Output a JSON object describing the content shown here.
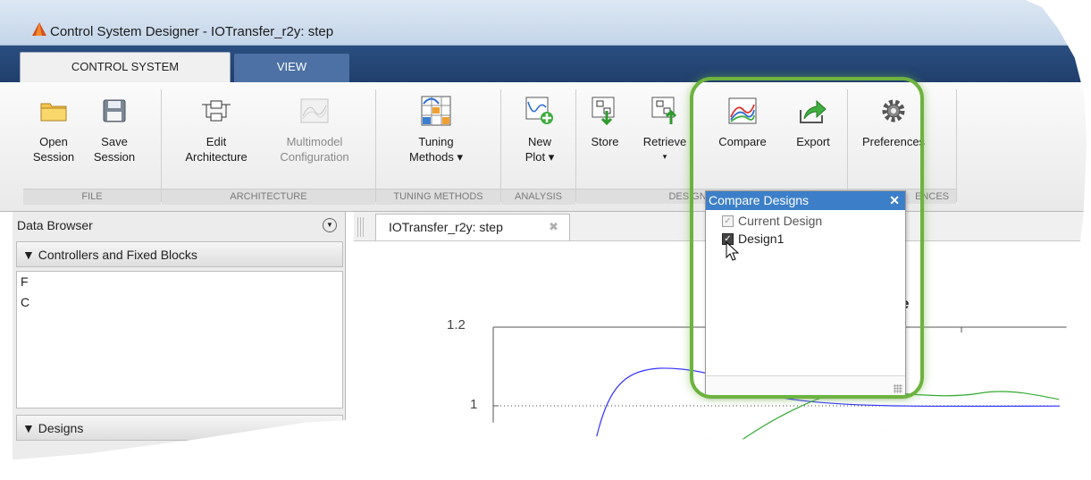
{
  "window": {
    "title": "Control System Designer - IOTransfer_r2y: step"
  },
  "tabs": [
    {
      "label": "CONTROL SYSTEM"
    },
    {
      "label": "VIEW"
    }
  ],
  "quick_access": [
    "help-icon",
    "dock-icon",
    "save-icon",
    "cut-icon"
  ],
  "ribbon": {
    "buttons": [
      {
        "line1": "Open",
        "line2": "Session",
        "icon": "folder-icon"
      },
      {
        "line1": "Save",
        "line2": "Session",
        "icon": "floppy-icon"
      },
      {
        "line1": "Edit",
        "line2": "Architecture",
        "icon": "block-diagram-icon"
      },
      {
        "line1": "Multimodel",
        "line2": "Configuration",
        "icon": "multimodel-icon",
        "disabled": true
      },
      {
        "line1": "Tuning",
        "line2": "Methods ▾",
        "icon": "tuning-icon"
      },
      {
        "line1": "New",
        "line2": "Plot ▾",
        "icon": "new-plot-icon"
      },
      {
        "line1": "Store",
        "line2": "",
        "icon": "store-icon"
      },
      {
        "line1": "Retrieve",
        "line2": "▾",
        "icon": "retrieve-icon"
      },
      {
        "line1": "Compare",
        "line2": "",
        "icon": "compare-icon"
      },
      {
        "line1": "Export",
        "line2": "",
        "icon": "export-icon"
      },
      {
        "line1": "Preferences",
        "line2": "",
        "icon": "gear-icon"
      }
    ],
    "groups": [
      "FILE",
      "ARCHITECTURE",
      "TUNING METHODS",
      "ANALYSIS",
      "DESIGNS",
      "ENCES"
    ]
  },
  "data_browser": {
    "title": "Data Browser",
    "controllers_header": "Controllers and Fixed Blocks",
    "controllers": [
      "F",
      "C"
    ],
    "designs_header": "Designs"
  },
  "document": {
    "tab_label": "IOTransfer_r2y: step",
    "title_fragment": "e",
    "y_ticks": [
      "1.2",
      "1"
    ]
  },
  "compare_popup": {
    "title": "Compare Designs",
    "items": [
      {
        "label": "Current Design",
        "checked": true,
        "disabled": true
      },
      {
        "label": "Design1",
        "checked": true,
        "disabled": false
      }
    ]
  },
  "colors": {
    "tab_strip": "#203f6c",
    "popup_header": "#3c7fc8",
    "highlight": "#6db33f",
    "curve_blue": "#3333ff",
    "curve_green": "#33aa33"
  }
}
